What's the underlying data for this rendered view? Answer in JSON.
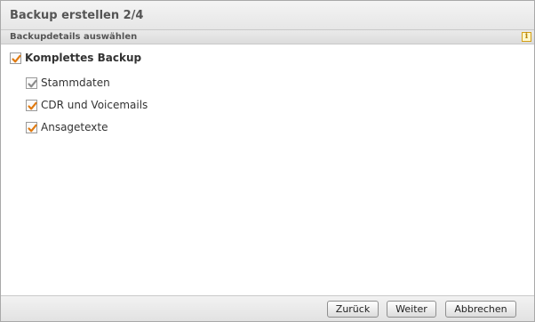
{
  "dialog": {
    "title": "Backup erstellen 2/4",
    "section_title": "Backupdetails auswählen",
    "info_icon": "i"
  },
  "options": {
    "complete_backup": {
      "label": "Komplettes Backup",
      "checked": true
    },
    "items": [
      {
        "label": "Stammdaten",
        "checked": true,
        "disabled": true
      },
      {
        "label": "CDR und Voicemails",
        "checked": true,
        "disabled": false
      },
      {
        "label": "Ansagetexte",
        "checked": true,
        "disabled": false
      }
    ]
  },
  "footer": {
    "back_label": "Zurück",
    "next_label": "Weiter",
    "cancel_label": "Abbrechen"
  },
  "colors": {
    "check_active": "#e07a10",
    "check_disabled": "#8c8c8c"
  },
  "icons": {
    "info": "info-icon",
    "checkbox": "checkbox-checked-icon"
  }
}
